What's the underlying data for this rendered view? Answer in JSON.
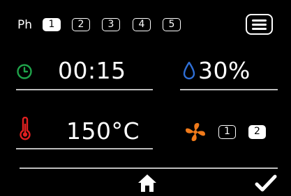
{
  "header": {
    "phase_label": "Ph",
    "phases": [
      "1",
      "2",
      "3",
      "4",
      "5"
    ],
    "active_phase": "1"
  },
  "timer": {
    "value": "00:15",
    "icon": "clock-icon",
    "icon_color": "#1fa34a"
  },
  "humidity": {
    "value": "30%",
    "icon": "water-drop-icon",
    "icon_color": "#2f6fd6"
  },
  "temperature": {
    "value": "150°C",
    "icon": "thermometer-icon",
    "icon_color": "#e02020"
  },
  "fan": {
    "icon": "fan-icon",
    "icon_color": "#f07a1a",
    "speeds": [
      "1",
      "2"
    ],
    "active_speed": "2"
  },
  "navigation": {
    "home_icon": "home-icon",
    "confirm_icon": "checkmark-icon",
    "menu_icon": "hamburger-menu-icon"
  }
}
